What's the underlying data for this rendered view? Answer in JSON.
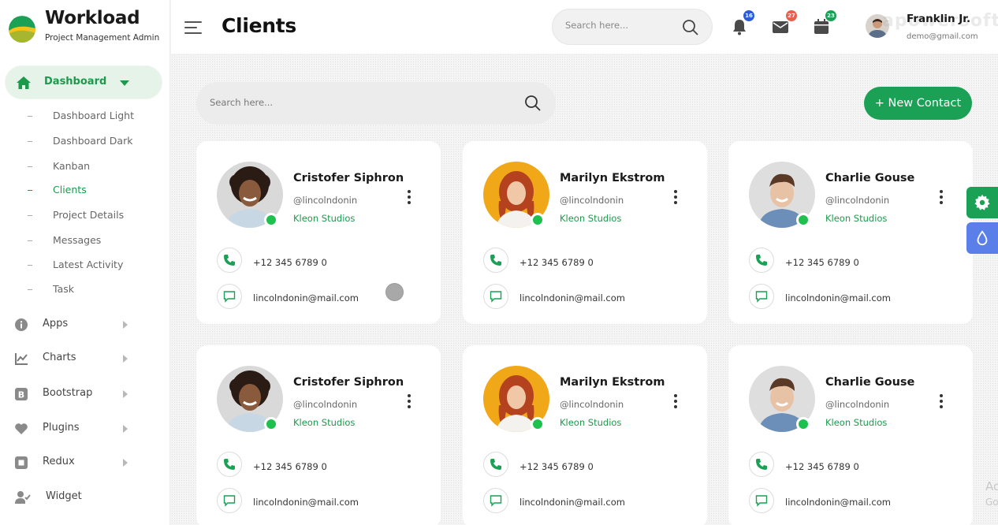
{
  "brand": {
    "title": "Workload",
    "subtitle": "Project Management Admin"
  },
  "sidebar": {
    "dashboard": {
      "label": "Dashboard"
    },
    "dashboard_items": [
      {
        "label": "Dashboard Light",
        "active": false
      },
      {
        "label": "Dashboard Dark",
        "active": false
      },
      {
        "label": "Kanban",
        "active": false
      },
      {
        "label": "Clients",
        "active": true
      },
      {
        "label": "Project Details",
        "active": false
      },
      {
        "label": "Messages",
        "active": false
      },
      {
        "label": "Latest Activity",
        "active": false
      },
      {
        "label": "Task",
        "active": false
      }
    ],
    "items": [
      {
        "label": "Apps",
        "icon": "info-icon"
      },
      {
        "label": "Charts",
        "icon": "chart-icon"
      },
      {
        "label": "Bootstrap",
        "icon": "bootstrap-icon"
      },
      {
        "label": "Plugins",
        "icon": "heart-icon"
      },
      {
        "label": "Redux",
        "icon": "redux-icon"
      },
      {
        "label": "Widget",
        "icon": "user-check-icon"
      }
    ]
  },
  "header": {
    "title": "Clients",
    "search_placeholder": "Search here...",
    "notifications": {
      "count": "16",
      "color": "#2d5bd7"
    },
    "messages": {
      "count": "27",
      "color": "#e8604c"
    },
    "calendar": {
      "count": "23",
      "color": "#1aa156"
    },
    "user": {
      "name": "Franklin Jr.",
      "email": "demo@gmail.com"
    }
  },
  "main": {
    "search_placeholder": "Search here...",
    "new_contact_label": "+ New Contact"
  },
  "clients": [
    {
      "name": "Cristofer Siphron",
      "handle": "@lincolndonin",
      "company": "Kleon Studios",
      "phone": "+12 345 6789 0",
      "email": "lincolndonin@mail.com"
    },
    {
      "name": "Marilyn Ekstrom",
      "handle": "@lincolndonin",
      "company": "Kleon Studios",
      "phone": "+12 345 6789 0",
      "email": "lincolndonin@mail.com"
    },
    {
      "name": "Charlie Gouse",
      "handle": "@lincolndonin",
      "company": "Kleon Studios",
      "phone": "+12 345 6789 0",
      "email": "lincolndonin@mail.com"
    },
    {
      "name": "Cristofer Siphron",
      "handle": "@lincolndonin",
      "company": "Kleon Studios",
      "phone": "+12 345 6789 0",
      "email": "lincolndonin@mail.com"
    },
    {
      "name": "Marilyn Ekstrom",
      "handle": "@lincolndonin",
      "company": "Kleon Studios",
      "phone": "+12 345 6789 0",
      "email": "lincolndonin@mail.com"
    },
    {
      "name": "Charlie Gouse",
      "handle": "@lincolndonin",
      "company": "Kleon Studios",
      "phone": "+12 345 6789 0",
      "email": "lincolndonin@mail.com"
    }
  ],
  "colors": {
    "accent": "#1aa156",
    "accent_light": "#e6f3e9",
    "online": "#1ec04e",
    "theme_button": "#5b7fe8"
  },
  "watermark": "apowersoft",
  "activate_windows": {
    "line1": "Ac",
    "line2": "Go"
  }
}
